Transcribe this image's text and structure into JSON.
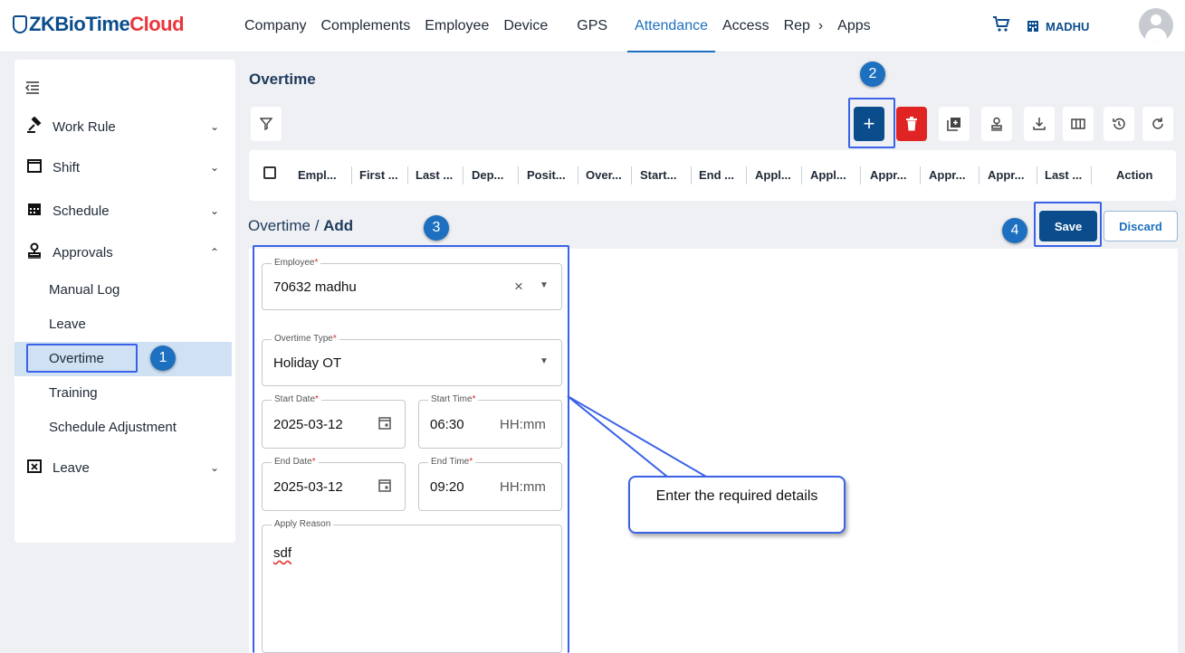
{
  "app": {
    "logo_main": "ZKBioTime",
    "logo_accent": "Cloud"
  },
  "nav": {
    "items": [
      "Company",
      "Complements",
      "Employee",
      "Device",
      "GPS",
      "Attendance",
      "Access",
      "Rep",
      "Apps"
    ],
    "more_label": "›",
    "active": "Attendance",
    "user_name": "MADHU"
  },
  "sidebar": {
    "groups": [
      {
        "label": "Work Rule",
        "icon": "gavel-icon"
      },
      {
        "label": "Shift",
        "icon": "calendar-outline-icon"
      },
      {
        "label": "Schedule",
        "icon": "calendar-grid-icon"
      },
      {
        "label": "Approvals",
        "icon": "stamp-icon"
      },
      {
        "label": "Leave",
        "icon": "calendar-x-icon"
      }
    ],
    "approvals_items": [
      "Manual Log",
      "Leave",
      "Overtime",
      "Training",
      "Schedule Adjustment"
    ],
    "active_item": "Overtime"
  },
  "page": {
    "title": "Overtime"
  },
  "table": {
    "columns": [
      "Empl...",
      "First ...",
      "Last ...",
      "Dep...",
      "Posit...",
      "Over...",
      "Start...",
      "End ...",
      "Appl...",
      "Appl...",
      "Appr...",
      "Appr...",
      "Appr...",
      "Last ...",
      "Action"
    ]
  },
  "breadcrumb": {
    "parent": "Overtime",
    "separator": " / ",
    "current": "Add"
  },
  "actions": {
    "save": "Save",
    "discard": "Discard"
  },
  "form": {
    "employee": {
      "label": "Employee",
      "value": "70632 madhu"
    },
    "overtime_type": {
      "label": "Overtime Type",
      "value": "Holiday OT"
    },
    "start_date": {
      "label": "Start Date",
      "value": "2025-03-12"
    },
    "start_time": {
      "label": "Start Time",
      "value": "06:30",
      "format": "HH:mm"
    },
    "end_date": {
      "label": "End Date",
      "value": "2025-03-12"
    },
    "end_time": {
      "label": "End Time",
      "value": "09:20",
      "format": "HH:mm"
    },
    "apply_reason": {
      "label": "Apply Reason",
      "value": "sdf"
    },
    "required_mark": "*"
  },
  "annotations": {
    "steps": [
      "1",
      "2",
      "3",
      "4"
    ],
    "callout": "Enter the required details",
    "highlight_color": "#3b62e8",
    "badge_color": "#1d6fbf"
  }
}
